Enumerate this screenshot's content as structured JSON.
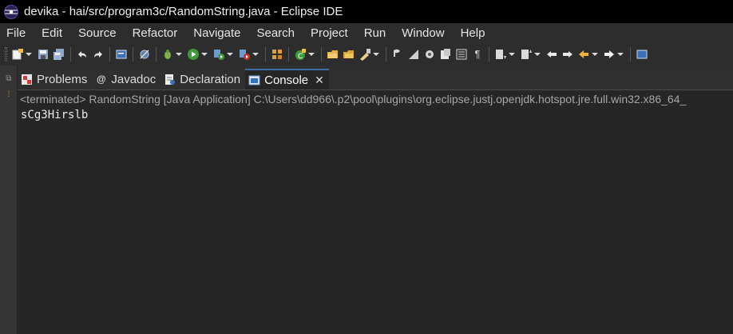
{
  "window": {
    "title": "devika - hai/src/program3c/RandomString.java - Eclipse IDE",
    "app_icon": "eclipse-logo-icon"
  },
  "menu": [
    "File",
    "Edit",
    "Source",
    "Refactor",
    "Navigate",
    "Search",
    "Project",
    "Run",
    "Window",
    "Help"
  ],
  "toolbar": {
    "icons": [
      "new-icon",
      "save-icon",
      "save-all-icon",
      "undo-icon",
      "redo-icon",
      "terminal-icon",
      "skip-breakpoints-icon",
      "debug-icon",
      "run-icon",
      "coverage-icon",
      "external-tools-icon",
      "new-java-package-icon",
      "new-java-class-icon",
      "open-type-icon",
      "open-task-icon",
      "search-icon",
      "annotation-icon",
      "pin-icon",
      "link-icon",
      "toggle-mark-occurrences-icon",
      "block-selection-icon",
      "show-whitespace-icon",
      "next-annotation-icon",
      "prev-annotation-icon",
      "last-edit-icon",
      "back-icon",
      "forward-icon",
      "new-window-icon"
    ]
  },
  "tabs": [
    {
      "label": "Problems",
      "icon": "problems-icon",
      "active": false
    },
    {
      "label": "Javadoc",
      "icon": "javadoc-icon",
      "active": false
    },
    {
      "label": "Declaration",
      "icon": "declaration-icon",
      "active": false
    },
    {
      "label": "Console",
      "icon": "console-icon",
      "active": true,
      "close_icon": "close-icon"
    }
  ],
  "console": {
    "header": "<terminated> RandomString [Java Application] C:\\Users\\dd966\\.p2\\pool\\plugins\\org.eclipse.justj.openjdk.hotspot.jre.full.win32.x86_64_",
    "output": "sCg3Hirslb"
  },
  "colors": {
    "accent_tab": "#3c6ea5",
    "console_bg": "#262626",
    "chrome_bg": "#2d2d2d"
  }
}
